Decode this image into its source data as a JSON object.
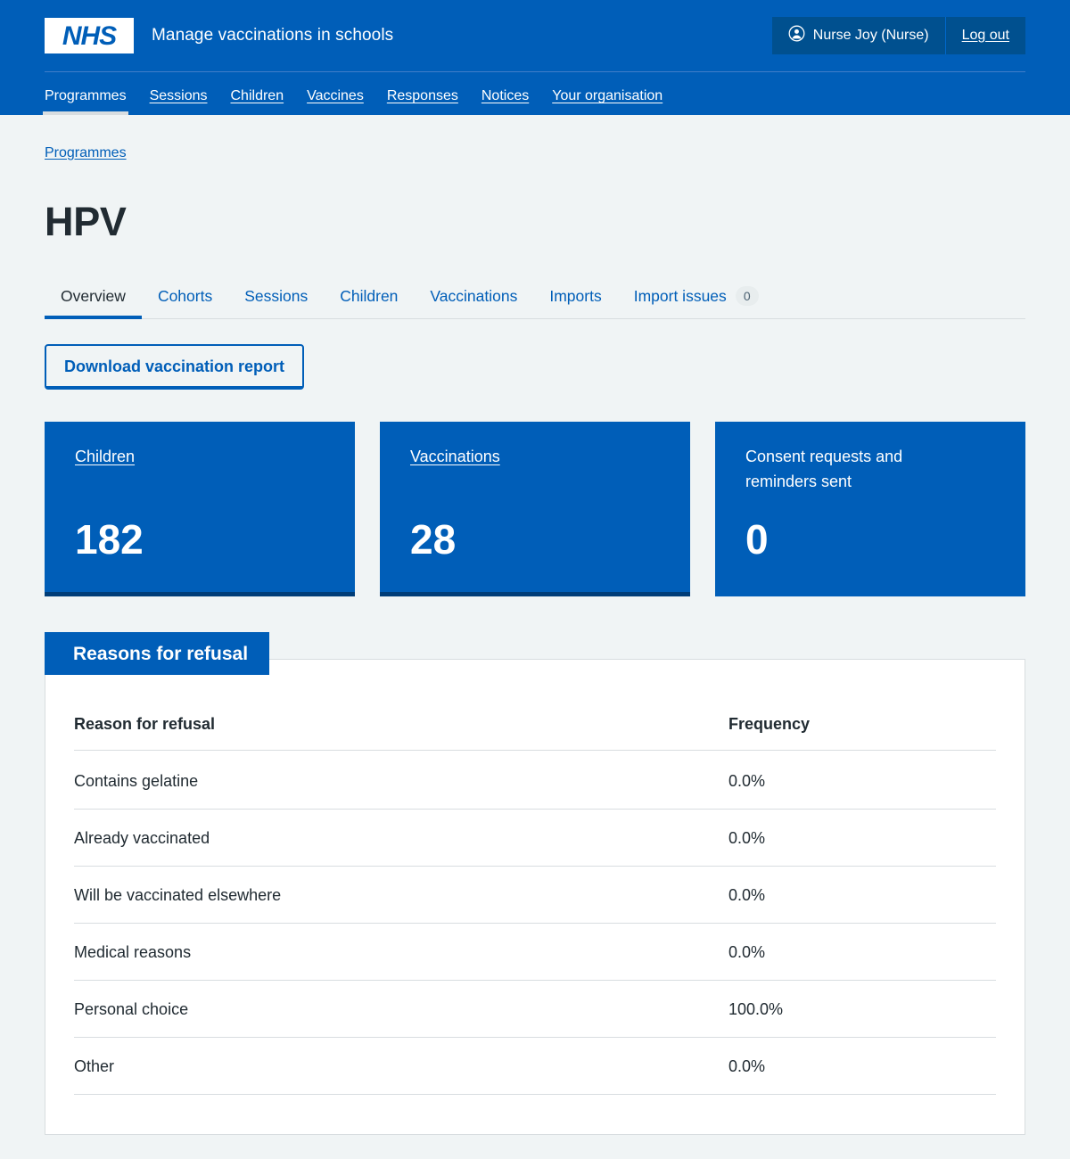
{
  "header": {
    "logo_text": "NHS",
    "service_name": "Manage vaccinations in schools",
    "user_name": "Nurse Joy (Nurse)",
    "logout_label": "Log out",
    "user_icon": "account-circle-icon"
  },
  "primary_nav": {
    "items": [
      {
        "label": "Programmes",
        "active": true
      },
      {
        "label": "Sessions",
        "active": false
      },
      {
        "label": "Children",
        "active": false
      },
      {
        "label": "Vaccines",
        "active": false
      },
      {
        "label": "Responses",
        "active": false
      },
      {
        "label": "Notices",
        "active": false
      },
      {
        "label": "Your organisation",
        "active": false
      }
    ]
  },
  "breadcrumb": {
    "label": "Programmes"
  },
  "page": {
    "title": "HPV"
  },
  "tabs": [
    {
      "label": "Overview",
      "badge": null,
      "active": true
    },
    {
      "label": "Cohorts",
      "badge": null,
      "active": false
    },
    {
      "label": "Sessions",
      "badge": null,
      "active": false
    },
    {
      "label": "Children",
      "badge": null,
      "active": false
    },
    {
      "label": "Vaccinations",
      "badge": null,
      "active": false
    },
    {
      "label": "Imports",
      "badge": null,
      "active": false
    },
    {
      "label": "Import issues",
      "badge": "0",
      "active": false
    }
  ],
  "actions": {
    "download_report_label": "Download vaccination report"
  },
  "stat_cards": [
    {
      "label": "Children",
      "value": "182",
      "is_link": true
    },
    {
      "label": "Vaccinations",
      "value": "28",
      "is_link": true
    },
    {
      "label": "Consent requests and reminders sent",
      "value": "0",
      "is_link": false
    }
  ],
  "refusal_panel": {
    "heading": "Reasons for refusal",
    "columns": [
      "Reason for refusal",
      "Frequency"
    ],
    "rows": [
      {
        "reason": "Contains gelatine",
        "frequency": "0.0%"
      },
      {
        "reason": "Already vaccinated",
        "frequency": "0.0%"
      },
      {
        "reason": "Will be vaccinated elsewhere",
        "frequency": "0.0%"
      },
      {
        "reason": "Medical reasons",
        "frequency": "0.0%"
      },
      {
        "reason": "Personal choice",
        "frequency": "100.0%"
      },
      {
        "reason": "Other",
        "frequency": "0.0%"
      }
    ]
  },
  "colors": {
    "nhs_blue": "#005eb8",
    "nhs_dark_blue": "#003d78",
    "page_background": "#f0f4f5",
    "border_grey": "#d8dde0",
    "text": "#212b32"
  }
}
